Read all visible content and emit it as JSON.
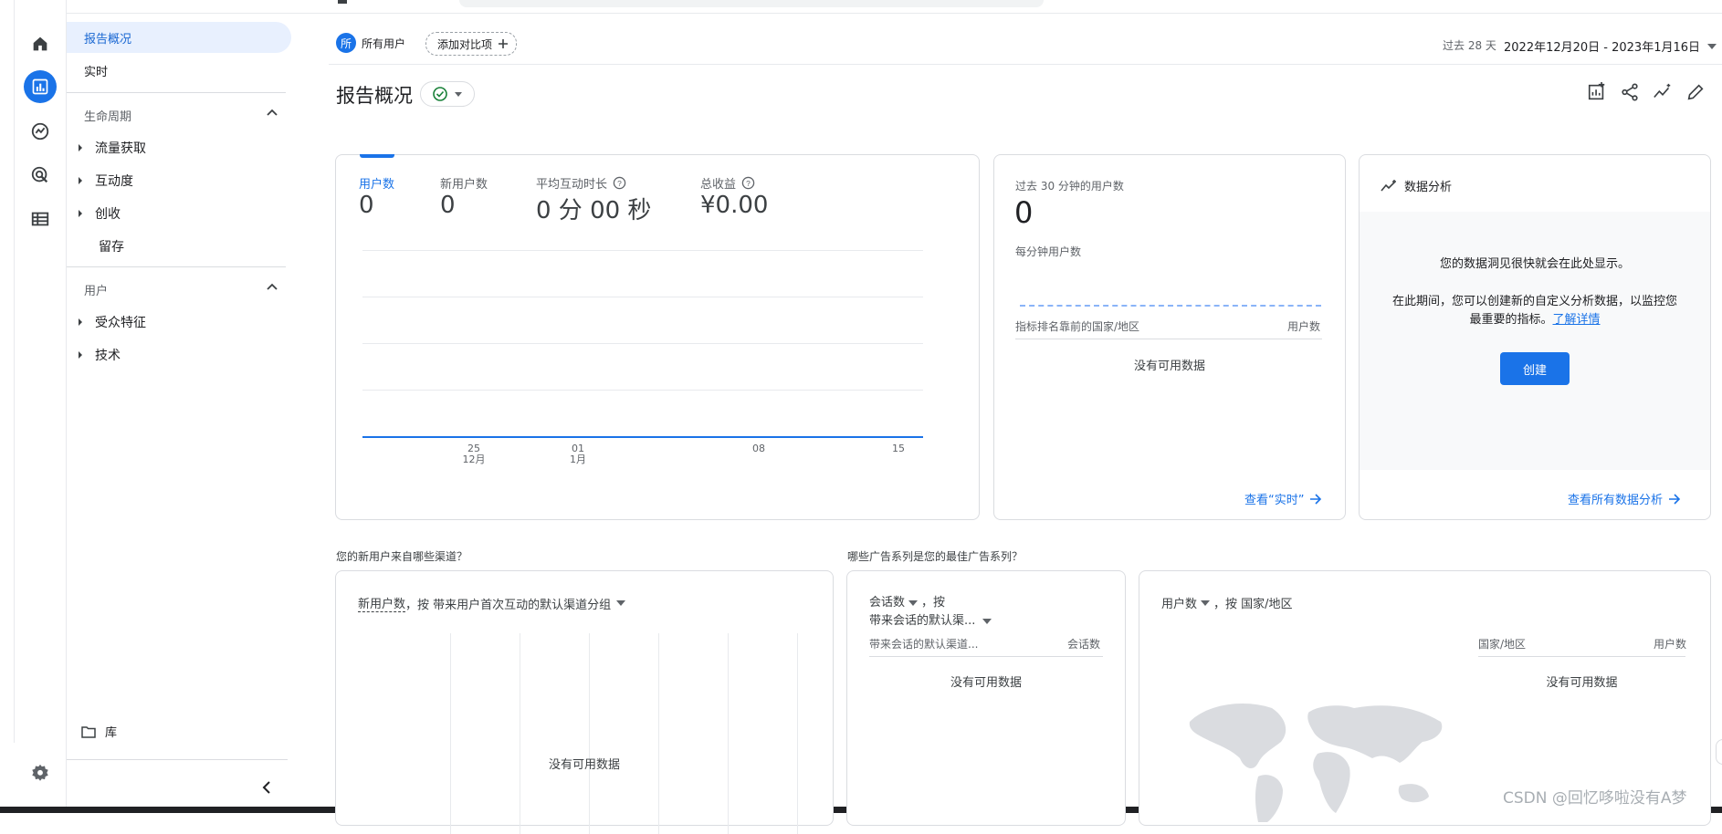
{
  "nav": {
    "overview": "报告概况",
    "realtime": "实时",
    "lifecycle": "生命周期",
    "lifecycle_items": [
      "流量获取",
      "互动度",
      "创收",
      "留存"
    ],
    "user": "用户",
    "user_items": [
      "受众特征",
      "技术"
    ],
    "library": "库"
  },
  "header": {
    "all_users_badge": "所",
    "all_users": "所有用户",
    "add_compare": "添加对比项",
    "date_prefix": "过去 28 天",
    "date_range": "2022年12月20日 - 2023年1月16日"
  },
  "page": {
    "title": "报告概况"
  },
  "summary_card": {
    "metrics": [
      {
        "label": "用户数",
        "value": "0"
      },
      {
        "label": "新用户数",
        "value": "0"
      },
      {
        "label": "平均互动时长",
        "value": "0 分 00 秒"
      },
      {
        "label": "总收益",
        "value": "¥0.00"
      }
    ],
    "ticks": [
      {
        "day": "25",
        "month": "12月"
      },
      {
        "day": "01",
        "month": "1月"
      },
      {
        "day": "08",
        "month": ""
      },
      {
        "day": "15",
        "month": ""
      }
    ]
  },
  "realtime_card": {
    "title": "过去 30 分钟的用户数",
    "value": "0",
    "per_minute": "每分钟用户数",
    "col_country": "指标排名靠前的国家/地区",
    "col_users": "用户数",
    "empty": "没有可用数据",
    "link": "查看“实时”"
  },
  "insights_card": {
    "title": "数据分析",
    "line1": "您的数据洞见很快就会在此处显示。",
    "line2a": "在此期间，您可以创建新的自定义分析数据，以监控您",
    "line2b": "最重要的指标。",
    "learn_more": "了解详情",
    "create": "创建",
    "link": "查看所有数据分析"
  },
  "sections": {
    "new_users_q": "您的新用户来自哪些渠道？",
    "campaigns_q": "哪些广告系列是您的最佳广告系列？"
  },
  "new_users_card": {
    "metric": "新用户数",
    "rest": "，按 带来用户首次互动的默认渠道分组",
    "empty": "没有可用数据"
  },
  "sessions_card": {
    "metric": "会话数",
    "by": "，按",
    "dimension": "带来会话的默认渠...",
    "col_dim": "带来会话的默认渠道...",
    "col_val": "会话数",
    "empty": "没有可用数据"
  },
  "country_card": {
    "metric": "用户数",
    "rest": "，按 国家/地区",
    "col_country": "国家/地区",
    "col_users": "用户数",
    "empty": "没有可用数据"
  },
  "watermark": "CSDN @回忆哆啦没有A梦",
  "colors": {
    "accent": "#1a73e8",
    "nav_active_bg": "#e8f0fe"
  }
}
